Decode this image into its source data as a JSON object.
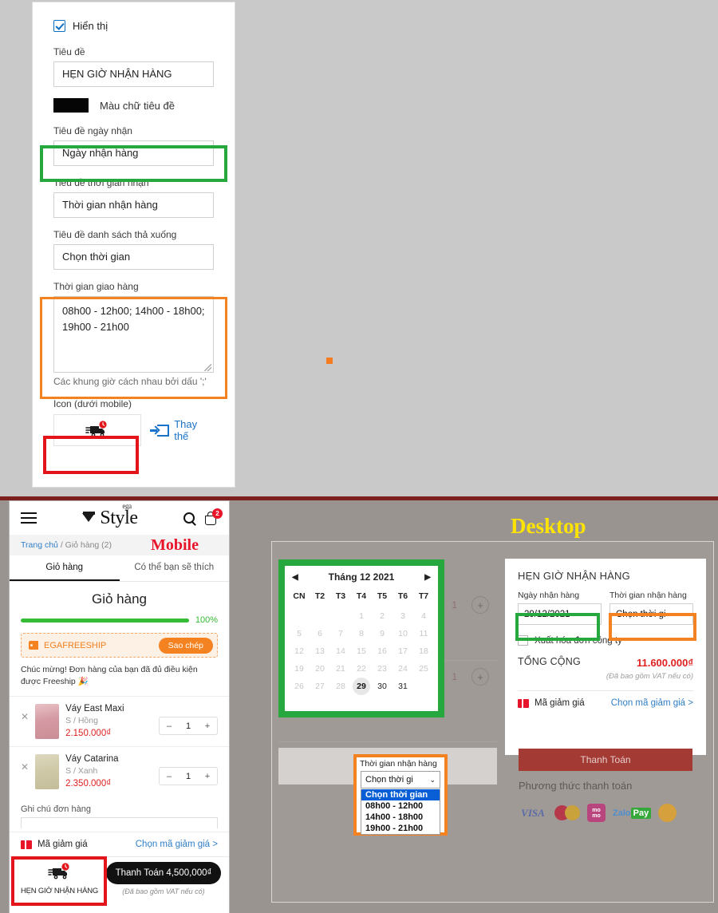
{
  "settings": {
    "visibility_checkbox_label": "Hiển thị",
    "title_label": "Tiêu đề",
    "title_value": "HẸN GIỜ NHẬN HÀNG",
    "title_color_label": "Màu chữ tiêu đề",
    "title_color_hex": "#050505",
    "date_label_label": "Tiêu đề ngày nhận",
    "date_label_value": "Ngày nhận hàng",
    "time_label_label": "Tiêu đề thời gian nhận",
    "time_label_value": "Thời gian nhận hàng",
    "dropdown_label_label": "Tiêu đề danh sách thả xuống",
    "dropdown_label_value": "Chọn thời gian",
    "slots_label": "Thời gian giao hàng",
    "slots_value": "08h00 - 12h00; 14h00 - 18h00; 19h00 - 21h00",
    "slots_hint": "Các khung giờ cách nhau bởi dấu ';'",
    "icon_label": "Icon (dưới mobile)",
    "replace_label": "Thay thế"
  },
  "mobile": {
    "watermark": "Mobile",
    "breadcrumb_home": "Trang chủ",
    "breadcrumb_current": "/ Giỏ hàng (2)",
    "cart_badge": "2",
    "logo_text": "Style",
    "logo_sup": "ega",
    "tabs": [
      {
        "label": "Giỏ hàng"
      },
      {
        "label": "Có thể bạn sẽ thích"
      }
    ],
    "page_title": "Giỏ hàng",
    "progress_value": "100%",
    "coupon_code": "EGAFREESHIP",
    "copy_label": "Sao chép",
    "freeship_note": "Chúc mừng! Đơn hàng của bạn đã đủ điều kiện được Freeship 🎉",
    "items": [
      {
        "name": "Váy East Maxi",
        "variant": "S / Hồng",
        "price": "2.150.000₫",
        "qty": "1"
      },
      {
        "name": "Váy Catarina",
        "variant": "S / Xanh",
        "price": "2.350.000₫",
        "qty": "1"
      }
    ],
    "note_label": "Ghi chú đơn hàng",
    "discount_label": "Mã giảm giá",
    "discount_link": "Chọn mã giảm giá >",
    "schedule_label": "HẸN GIỜ NHẬN HÀNG",
    "pay_button": "Thanh Toán 4,500,000₫",
    "pay_note": "(Đã bao gồm VAT nếu có)",
    "minus": "–",
    "plus": "+",
    "remove": "✕"
  },
  "desktop": {
    "watermark": "Desktop",
    "calendar": {
      "month_title": "Tháng 12  2021",
      "prev_arrow": "◀",
      "next_arrow": "▶",
      "dow": [
        "CN",
        "T2",
        "T3",
        "T4",
        "T5",
        "T6",
        "T7"
      ],
      "cells": [
        {
          "d": "",
          "state": "blank"
        },
        {
          "d": "",
          "state": "blank"
        },
        {
          "d": "",
          "state": "blank"
        },
        {
          "d": "1",
          "state": "disabled"
        },
        {
          "d": "2",
          "state": "disabled"
        },
        {
          "d": "3",
          "state": "disabled"
        },
        {
          "d": "4",
          "state": "disabled"
        },
        {
          "d": "5",
          "state": "disabled"
        },
        {
          "d": "6",
          "state": "disabled"
        },
        {
          "d": "7",
          "state": "disabled"
        },
        {
          "d": "8",
          "state": "disabled"
        },
        {
          "d": "9",
          "state": "disabled"
        },
        {
          "d": "10",
          "state": "disabled"
        },
        {
          "d": "11",
          "state": "disabled"
        },
        {
          "d": "12",
          "state": "disabled"
        },
        {
          "d": "13",
          "state": "disabled"
        },
        {
          "d": "14",
          "state": "disabled"
        },
        {
          "d": "15",
          "state": "disabled"
        },
        {
          "d": "16",
          "state": "disabled"
        },
        {
          "d": "17",
          "state": "disabled"
        },
        {
          "d": "18",
          "state": "disabled"
        },
        {
          "d": "19",
          "state": "disabled"
        },
        {
          "d": "20",
          "state": "disabled"
        },
        {
          "d": "21",
          "state": "disabled"
        },
        {
          "d": "22",
          "state": "disabled"
        },
        {
          "d": "23",
          "state": "disabled"
        },
        {
          "d": "24",
          "state": "disabled"
        },
        {
          "d": "25",
          "state": "disabled"
        },
        {
          "d": "26",
          "state": "disabled"
        },
        {
          "d": "27",
          "state": "disabled"
        },
        {
          "d": "28",
          "state": "disabled"
        },
        {
          "d": "29",
          "state": "selected"
        },
        {
          "d": "30",
          "state": "enabled"
        },
        {
          "d": "31",
          "state": "enabled"
        },
        {
          "d": "",
          "state": "blank"
        }
      ]
    },
    "dropdown_popup": {
      "label": "Thời gian nhận hàng",
      "selected": "Chọn thời gi",
      "caret": "❯",
      "options": [
        {
          "label": "Chọn thời gian",
          "selected": true
        },
        {
          "label": "08h00 - 12h00",
          "selected": false
        },
        {
          "label": "14h00 - 18h00",
          "selected": false
        },
        {
          "label": "19h00 - 21h00",
          "selected": false
        }
      ]
    },
    "checkout": {
      "title": "HẸN GIỜ NHẬN HÀNG",
      "date_label": "Ngày nhận hàng",
      "date_value": "29/12/2021",
      "time_label": "Thời gian nhận hàng",
      "time_value": "Chọn thời gi",
      "time_caret": "❯",
      "invoice_label": "Xuất hóa đơn công ty",
      "total_label": "TỔNG CỘNG",
      "total_value": "11.600.000₫",
      "total_note": "(Đã bao gồm VAT nếu có)",
      "discount_label": "Mã giảm giá",
      "discount_link": "Chọn mã giảm giá >",
      "pay_button": "Thanh Toán",
      "payment_methods_title": "Phương thức thanh toán",
      "payment_methods": [
        "VISA",
        "MasterCard",
        "momo",
        "ZaloPay",
        "COD"
      ]
    },
    "ghost_qty": "1",
    "ghost_plus": "+"
  }
}
